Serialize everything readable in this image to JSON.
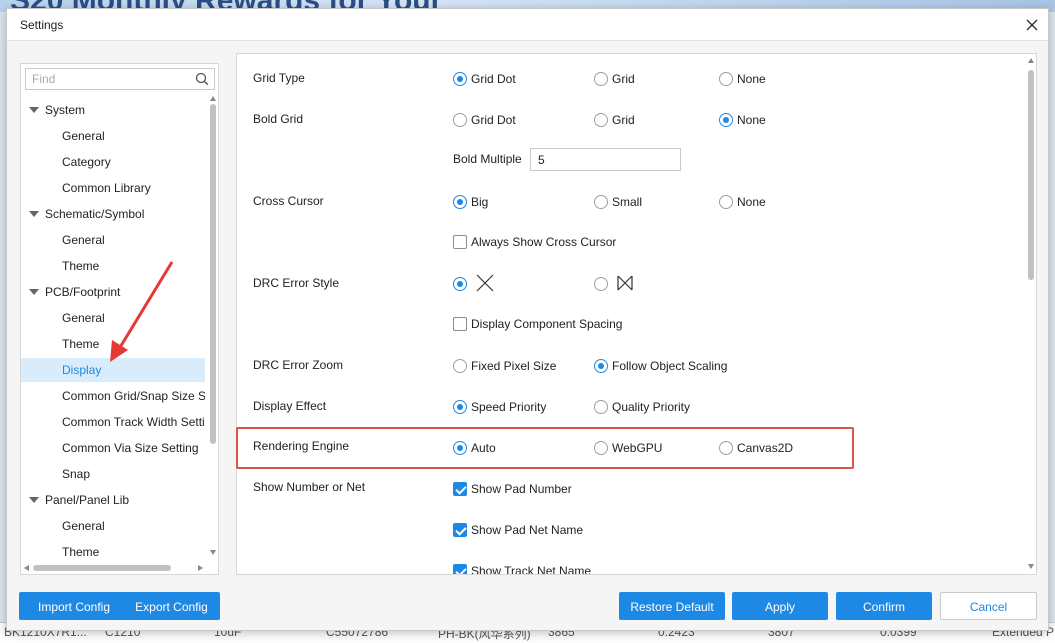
{
  "background": {
    "banner_text": "S20 Monthly Rewards for Your",
    "table_cells": [
      "BK1210X7R1...",
      "C1210",
      "10uF",
      "C55072786",
      "PH-BK(风华系列)",
      "3865",
      "0.2423",
      "3807",
      "0.0399",
      "Extended P"
    ]
  },
  "dialog": {
    "title": "Settings"
  },
  "tree": {
    "search_placeholder": "Find",
    "items": [
      {
        "label": "System",
        "type": "group"
      },
      {
        "label": "General",
        "type": "child"
      },
      {
        "label": "Category",
        "type": "child"
      },
      {
        "label": "Common Library",
        "type": "child"
      },
      {
        "label": "Schematic/Symbol",
        "type": "group"
      },
      {
        "label": "General",
        "type": "child"
      },
      {
        "label": "Theme",
        "type": "child"
      },
      {
        "label": "PCB/Footprint",
        "type": "group"
      },
      {
        "label": "General",
        "type": "child"
      },
      {
        "label": "Theme",
        "type": "child"
      },
      {
        "label": "Display",
        "type": "child",
        "selected": true
      },
      {
        "label": "Common Grid/Snap Size Setting",
        "type": "child"
      },
      {
        "label": "Common Track Width Setting",
        "type": "child"
      },
      {
        "label": "Common Via Size Setting",
        "type": "child"
      },
      {
        "label": "Snap",
        "type": "child"
      },
      {
        "label": "Panel/Panel Lib",
        "type": "group"
      },
      {
        "label": "General",
        "type": "child"
      },
      {
        "label": "Theme",
        "type": "child"
      }
    ]
  },
  "settings": {
    "grid_type": {
      "label": "Grid Type",
      "options": [
        "Grid Dot",
        "Grid",
        "None"
      ],
      "selected": "Grid Dot"
    },
    "bold_grid": {
      "label": "Bold Grid",
      "options": [
        "Grid Dot",
        "Grid",
        "None"
      ],
      "selected": "None"
    },
    "bold_multiple": {
      "label": "Bold Multiple",
      "value": "5"
    },
    "cross_cursor": {
      "label": "Cross Cursor",
      "options": [
        "Big",
        "Small",
        "None"
      ],
      "selected": "Big"
    },
    "always_show_cross_cursor": {
      "label": "Always Show Cross Cursor",
      "checked": false
    },
    "drc_error_style": {
      "label": "DRC Error Style",
      "options": [
        "x-mark-icon",
        "bowtie-icon"
      ],
      "selected": "x-mark-icon"
    },
    "display_component_spacing": {
      "label": "Display Component Spacing",
      "checked": false
    },
    "drc_error_zoom": {
      "label": "DRC Error Zoom",
      "options": [
        "Fixed Pixel Size",
        "Follow Object Scaling"
      ],
      "selected": "Follow Object Scaling"
    },
    "display_effect": {
      "label": "Display Effect",
      "options": [
        "Speed Priority",
        "Quality Priority"
      ],
      "selected": "Speed Priority"
    },
    "rendering_engine": {
      "label": "Rendering Engine",
      "options": [
        "Auto",
        "WebGPU",
        "Canvas2D"
      ],
      "selected": "Auto"
    },
    "show_number_or_net": {
      "label": "Show Number or Net",
      "checks": [
        {
          "label": "Show Pad Number",
          "checked": true
        },
        {
          "label": "Show Pad Net Name",
          "checked": true
        },
        {
          "label": "Show Track Net Name",
          "checked": true
        }
      ]
    }
  },
  "buttons": {
    "import_config": "Import Config",
    "export_config": "Export Config",
    "restore_default": "Restore Default",
    "apply": "Apply",
    "confirm": "Confirm",
    "cancel": "Cancel"
  },
  "colors": {
    "accent": "#1e88e5",
    "highlight_box": "#d9534f",
    "annotation_arrow": "#e53935"
  }
}
